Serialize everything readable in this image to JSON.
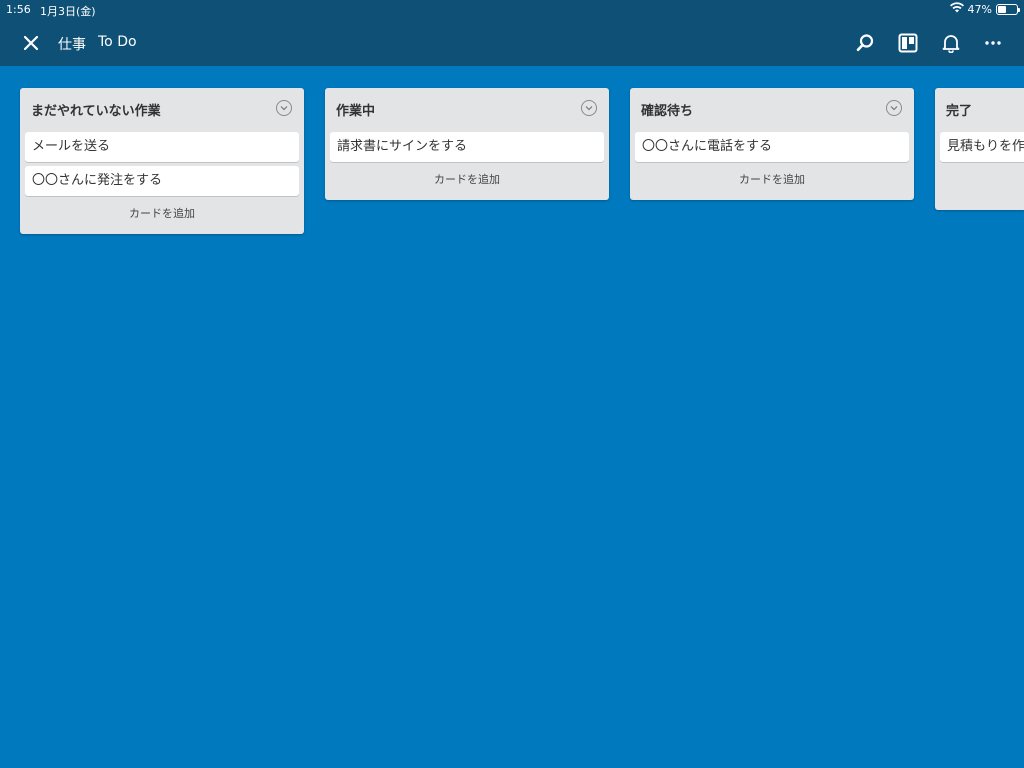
{
  "status": {
    "time": "1:56",
    "date": "1月3日(金)",
    "battery": "47%",
    "battery_level": 0.47
  },
  "header": {
    "board_group": "仕事",
    "board_name": "To Do",
    "icons": [
      "close-icon",
      "search-icon",
      "board-view-icon",
      "bell-icon",
      "more-icon"
    ]
  },
  "lists": [
    {
      "title": "まだやれていない作業",
      "cards": [
        "メールを送る",
        "〇〇さんに発注をする"
      ],
      "add_label": "カードを追加"
    },
    {
      "title": "作業中",
      "cards": [
        "請求書にサインをする"
      ],
      "add_label": "カードを追加"
    },
    {
      "title": "確認待ち",
      "cards": [
        "〇〇さんに電話をする"
      ],
      "add_label": "カードを追加"
    },
    {
      "title": "完了",
      "cards": [
        "見積もりを作"
      ],
      "add_label": ""
    }
  ],
  "colors": {
    "board_bg": "#0079bf",
    "header_bg": "#0f5077",
    "list_bg": "#e2e4e6",
    "card_bg": "#ffffff"
  }
}
